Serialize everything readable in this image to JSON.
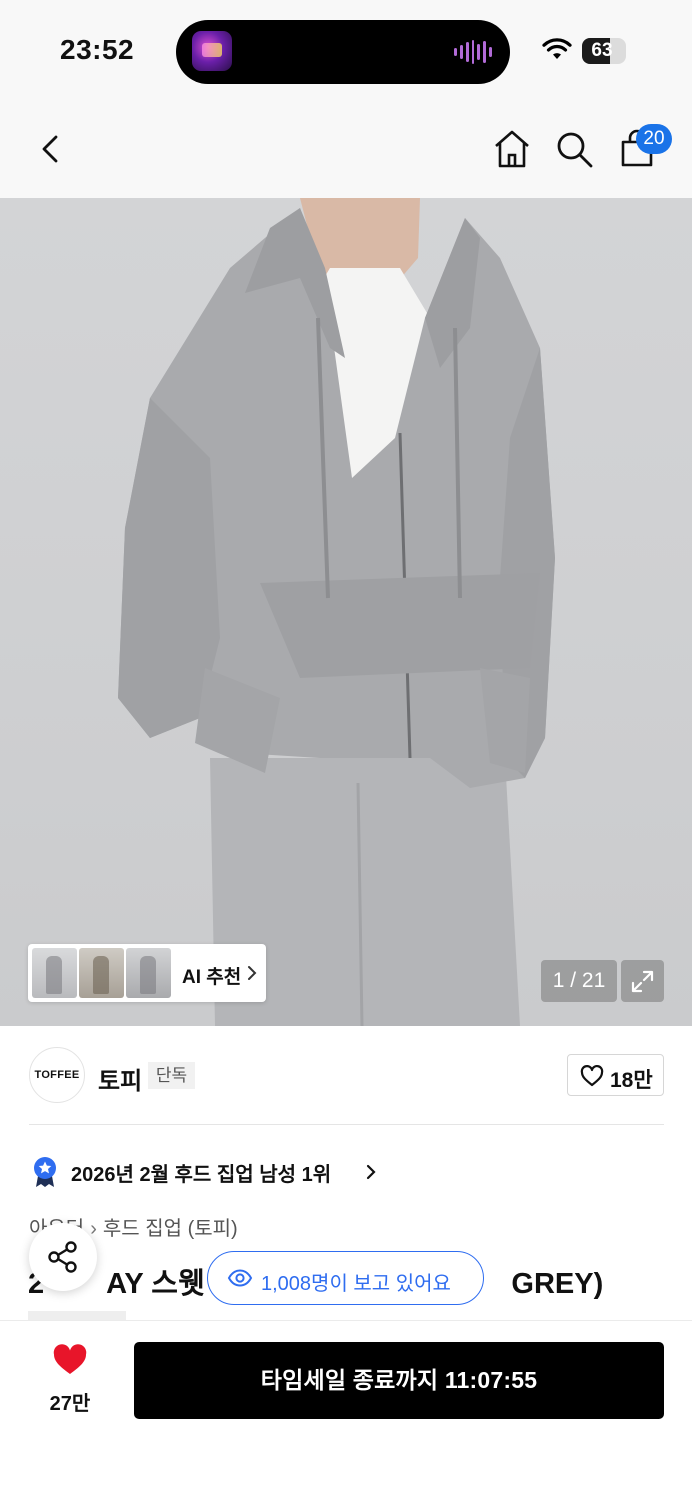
{
  "status_bar": {
    "time": "23:52",
    "battery_level": 63,
    "battery_label": "63",
    "icons": [
      "now-playing-app-icon",
      "audio-waveform-icon",
      "wifi-icon",
      "battery-icon"
    ]
  },
  "header": {
    "icons": [
      "back-icon",
      "home-icon",
      "search-icon",
      "shopping-bag-icon"
    ],
    "cart_count": "20",
    "badge_color": "#1a73e8"
  },
  "gallery": {
    "ai_recommend_label": "AI 추천",
    "pager": "1 / 21",
    "expand_icon": "expand-icon"
  },
  "brand": {
    "logo_text": "TOFFEE",
    "name": "토피",
    "badge": "단독",
    "like_count": "18만"
  },
  "ranking": {
    "text": "2026년 2월 후드 집업 남성 1위"
  },
  "breadcrumb": {
    "items": [
      "아우터",
      "후드 집업 (토피)"
    ]
  },
  "product": {
    "title_start": "2",
    "title_middle": "AY 스웻 후",
    "title_end": "GREY)"
  },
  "overlay": {
    "viewers_text": "1,008명이 보고 있어요",
    "accent_color": "#2f6df0"
  },
  "bottom_bar": {
    "wish_count": "27만",
    "cta_label": "타임세일 종료까지 11:07:55",
    "heart_color": "#e8152a"
  }
}
